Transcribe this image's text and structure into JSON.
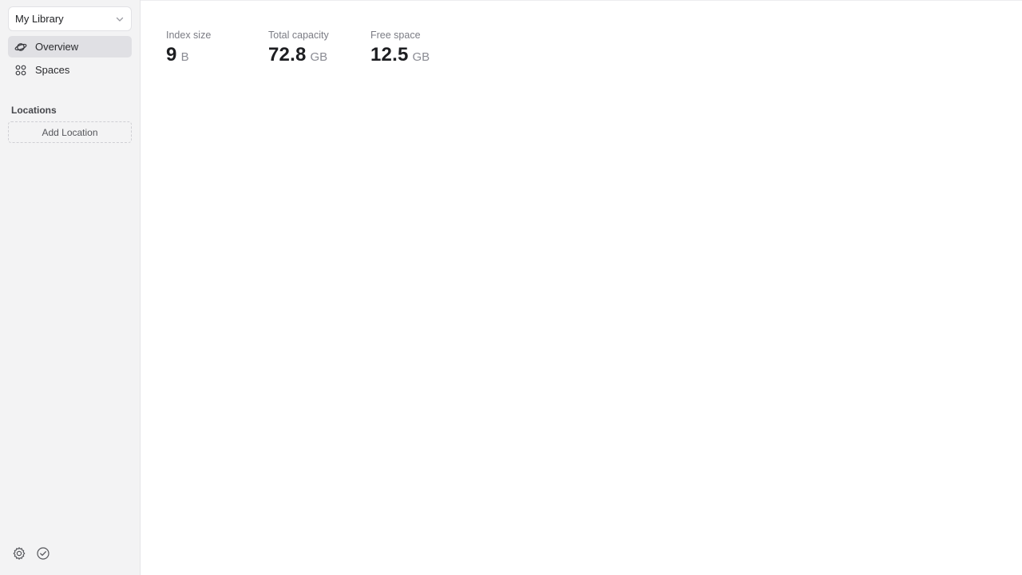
{
  "sidebar": {
    "library_select": {
      "label": "My Library"
    },
    "nav": [
      {
        "label": "Overview",
        "icon": "planet-icon",
        "active": true
      },
      {
        "label": "Spaces",
        "icon": "grid-icon",
        "active": false
      }
    ],
    "locations_section": {
      "title": "Locations",
      "add_label": "Add Location"
    },
    "footer": {
      "icons": [
        "gear-icon",
        "check-circle-icon"
      ]
    }
  },
  "main": {
    "stats": [
      {
        "label": "Index size",
        "value": "9",
        "unit": "B"
      },
      {
        "label": "Total capacity",
        "value": "72.8",
        "unit": "GB"
      },
      {
        "label": "Free space",
        "value": "12.5",
        "unit": "GB"
      }
    ]
  },
  "colors": {
    "sidebar_bg": "#f3f3f4",
    "active_item_bg": "#e0e0e4",
    "main_bg": "#ffffff"
  }
}
